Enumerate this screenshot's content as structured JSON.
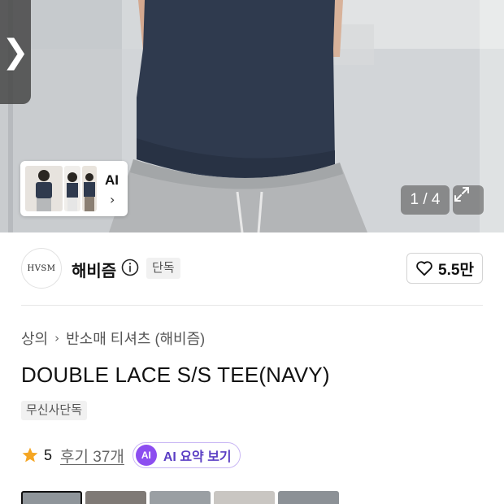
{
  "hero": {
    "counter": "1 / 4",
    "thumbnail_ai_label": "AI"
  },
  "brand": {
    "logo_text": "HVSM",
    "name": "해비즘",
    "badge": "단독",
    "likes": "5.5만"
  },
  "breadcrumb": {
    "items": [
      "상의",
      "반소매 티셔츠 (해비즘)"
    ]
  },
  "product": {
    "title": "DOUBLE LACE S/S TEE(NAVY)",
    "tag": "무신사단독"
  },
  "rating": {
    "value": "5",
    "reviews_label": "후기 37개",
    "ai_badge": "AI",
    "ai_summary_label": "AI 요약 보기"
  },
  "colors": {
    "accent_purple": "#8c4df0",
    "star": "#f5a623",
    "shirt_navy": "#2f3a4e"
  },
  "icons": [
    "chevron-left-icon",
    "chevron-right-icon",
    "expand-icon",
    "info-icon",
    "heart-icon",
    "star-icon",
    "chevron-right-small-icon"
  ]
}
